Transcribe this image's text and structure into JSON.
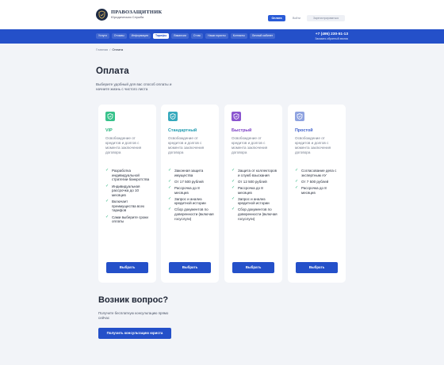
{
  "header": {
    "brand_name": "ПРАВОЗАЩИТНИК",
    "brand_sub": "Юридическая Служба",
    "pay_label": "Оплата",
    "login_label": "Войти",
    "register_label": "Зарегистрироваться",
    "logo_icon": "shield-icon"
  },
  "nav": {
    "items": [
      "Услуги",
      "Отзывы",
      "Информация",
      "Тарифы",
      "Вакансии",
      "О нас",
      "Наши юристы",
      "Контакты",
      "Личный кабинет"
    ],
    "active": "Тарифы",
    "phone": "+7 (495) 230-51-13",
    "callback": "Заказать обратный звонок"
  },
  "breadcrumb": {
    "home": "Главная",
    "separator": "/",
    "current": "Оплата"
  },
  "page": {
    "title": "Оплата",
    "intro": "Выберите удобный для вас способ оплаты и начните жизнь с чистого листа"
  },
  "plans": [
    {
      "name": "VIP",
      "color": "#22b27a",
      "icon_bg": "#37c28b",
      "icon": "shield-icon",
      "desc": "Освобождение от кредитов и долгов с момента заключения договора",
      "features": [
        "Разработка индивидуальной стратегии банкротства",
        "Индивидуальная рассрочка до 10 месяцев",
        "Включает преимущества всех тарифов",
        "Сами выберите сроки оплаты"
      ],
      "button": "Выбрать"
    },
    {
      "name": "Стандартный",
      "color": "#1f9bb0",
      "icon_bg": "#36a9bd",
      "icon": "shield-icon",
      "desc": "Освобождение от кредитов и долгов с момента заключения договора",
      "features": [
        "Законная защита имущества",
        "От 17 500 рублей",
        "Рассрочка до 8 месяцев",
        "Запрос и анализ кредитной истории",
        "Сбор документов по доверенности (включая госуслуги)"
      ],
      "button": "Выбрать"
    },
    {
      "name": "Быстрый",
      "color": "#7b3fc4",
      "icon_bg": "#8b55cf",
      "icon": "shield-icon",
      "desc": "Освобождение от кредитов и долгов с момента заключения договора",
      "features": [
        "Защита от коллекторов и служб взыскания",
        "От 12 500 рублей",
        "Рассрочка до 8 месяцев",
        "Запрос и анализ кредитной истории",
        "Сбор документов по доверенности (включая госуслуги)"
      ],
      "button": "Выбрать"
    },
    {
      "name": "Простой",
      "color": "#3d5fcb",
      "icon_bg": "#8fa3e0",
      "icon": "shield-icon",
      "desc": "Освобождение от кредитов и долгов с момента заключения договора",
      "features": [
        "Согласование дела с экспертным АУ",
        "От 7 500 рублей",
        "Рассрочка до 8 месяцев"
      ],
      "button": "Выбрать"
    }
  ],
  "question": {
    "title": "Возник вопрос?",
    "text": "Получите бесплатную консультацию прямо сейчас",
    "button": "Получить консультацию юриста"
  }
}
